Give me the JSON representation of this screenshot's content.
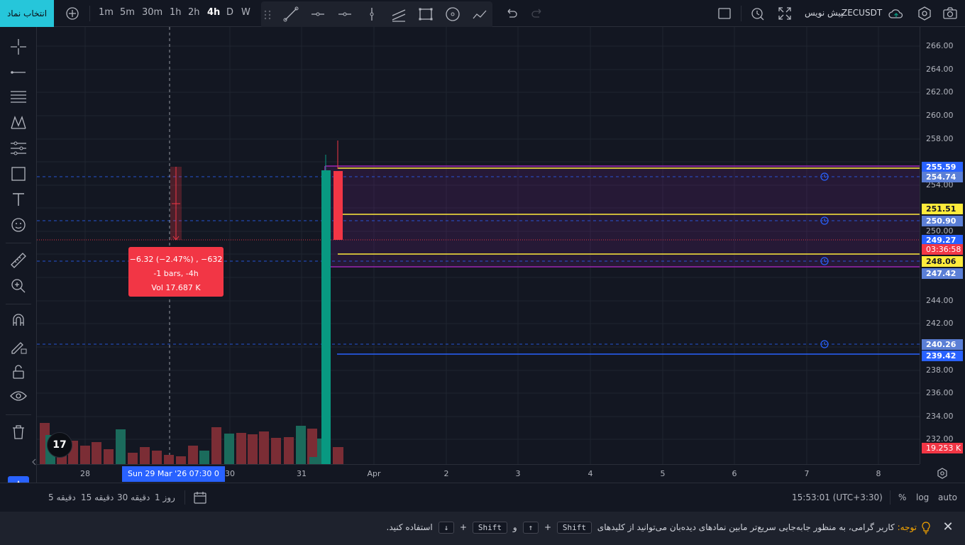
{
  "topbar": {
    "symbol_search_label": "انتخاب نماد",
    "timeframes": [
      "1m",
      "5m",
      "30m",
      "1h",
      "2h",
      "4h",
      "D",
      "W"
    ],
    "active_timeframe": "4h",
    "symbol": "ZECUSDT",
    "symbol_tag": "پیش نویس"
  },
  "price_axis": {
    "ticks": [
      "266.00",
      "264.00",
      "262.00",
      "260.00",
      "258.00",
      "254.00",
      "250.00",
      "244.00",
      "242.00",
      "238.00",
      "236.00",
      "234.00",
      "232.00"
    ],
    "labels": {
      "l255_59": "255.59",
      "l254_74": "254.74",
      "l251_51": "251.51",
      "l250_90": "250.90",
      "l249_27": "249.27",
      "countdown": "03:36:58",
      "l248_06": "248.06",
      "l247_42": "247.42",
      "l240_26": "240.26",
      "l239_42": "239.42",
      "volume": "19.253 K"
    },
    "colors": {
      "blue": "#2962ff",
      "yellow": "#ffeb3b",
      "red": "#f23645"
    }
  },
  "time_axis": {
    "ticks": [
      "28",
      "30",
      "31",
      "Apr",
      "2",
      "3",
      "4",
      "5",
      "6",
      "7",
      "8"
    ],
    "crosshair_label": "Sun 29 Mar '26   07:30   0"
  },
  "measure": {
    "line1": "−6.32 (−2.47%) , −632",
    "line2": "-1 bars, -4h",
    "line3": "Vol 17.687 K"
  },
  "bottombar": {
    "ranges": [
      "روز 1",
      "دقیقه 30",
      "دقیقه 15",
      "دقیقه 5"
    ],
    "clock": "15:53:01 (UTC+3:30)",
    "pct": "%",
    "log": "log",
    "auto": "auto"
  },
  "notice": {
    "title": "توجه:",
    "text1": "کاربر گرامی، به منظور جابه‌جایی سریع‌تر مابین نمادهای دیده‌بان می‌توانید از کلیدهای",
    "key1": "Shift",
    "plus1": "+",
    "key2": "↑",
    "and": "و",
    "key3": "Shift",
    "plus2": "+",
    "key4": "↓",
    "text2": "استفاده کنید."
  },
  "logo": "17",
  "colors": {
    "up": "#089981",
    "down": "#f23645",
    "accent": "#26c6da",
    "purple": "#9c27b0"
  }
}
